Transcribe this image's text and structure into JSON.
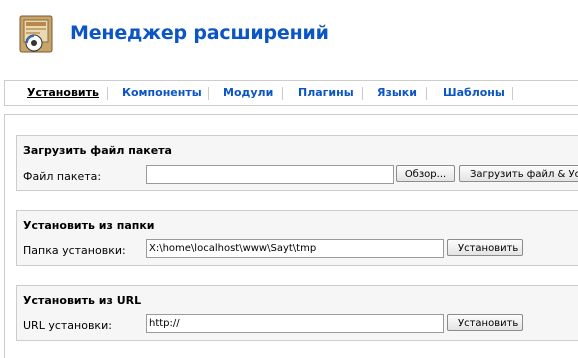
{
  "header": {
    "title": "Менеджер расширений",
    "icon": "install-icon"
  },
  "tabs": [
    {
      "label": "Установить",
      "active": true
    },
    {
      "label": "Компоненты",
      "active": false
    },
    {
      "label": "Модули",
      "active": false
    },
    {
      "label": "Плагины",
      "active": false
    },
    {
      "label": "Языки",
      "active": false
    },
    {
      "label": "Шаблоны",
      "active": false
    }
  ],
  "upload_package": {
    "title": "Загрузить файл пакета",
    "label": "Файл пакета:",
    "value": "",
    "browse_label": "Обзор...",
    "submit_label": "Загрузить файл & Установить"
  },
  "install_folder": {
    "title": "Установить из папки",
    "label": "Папка установки:",
    "value": "X:\\home\\localhost\\www\\Sayt\\tmp",
    "submit_label": "Установить"
  },
  "install_url": {
    "title": "Установить из URL",
    "label": "URL установки:",
    "value": "http://",
    "submit_label": "Установить"
  },
  "colors": {
    "title_blue": "#0b55c4",
    "border": "#cccccc",
    "section_bg": "#f6f6f6"
  }
}
